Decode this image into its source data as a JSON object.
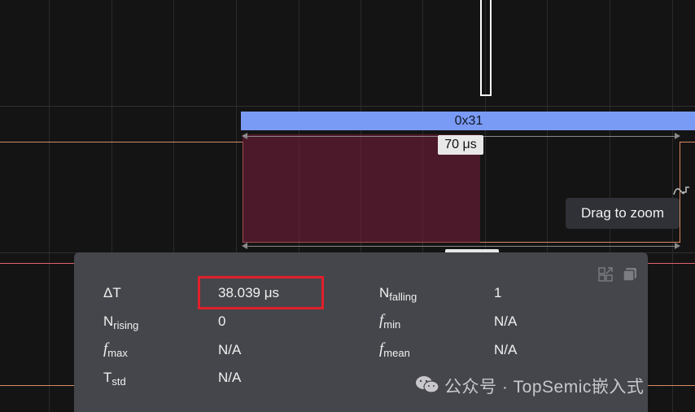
{
  "protocol": {
    "value": "0x31"
  },
  "duration": {
    "label": "70 μs"
  },
  "tooltip": {
    "text": "Drag to zoom"
  },
  "measurements": {
    "delta_t_label": "ΔT",
    "delta_t_value": "38.039 μs",
    "n_falling_base": "N",
    "n_falling_sub": "falling",
    "n_falling_value": "1",
    "n_rising_base": "N",
    "n_rising_sub": "rising",
    "n_rising_value": "0",
    "f_min_base": "f",
    "f_min_sub": "min",
    "f_min_value": "N/A",
    "f_max_base": "f",
    "f_max_sub": "max",
    "f_max_value": "N/A",
    "f_mean_base": "f",
    "f_mean_sub": "mean",
    "f_mean_value": "N/A",
    "t_std_base": "T",
    "t_std_sub": "std",
    "t_std_value": "N/A"
  },
  "watermark": {
    "text": "公众号 · TopSemic嵌入式"
  },
  "icons": [
    "expand-icon",
    "copy-icon",
    "wechat-icon",
    "trigger-icon"
  ],
  "colors": {
    "background": "#141414",
    "protocol_bar": "#7a9bf5",
    "highlight": "#5a1e32",
    "channel_trace": "#d88a64",
    "red_trace": "#e06070",
    "panel": "#45464b",
    "callout": "#e0202a"
  }
}
